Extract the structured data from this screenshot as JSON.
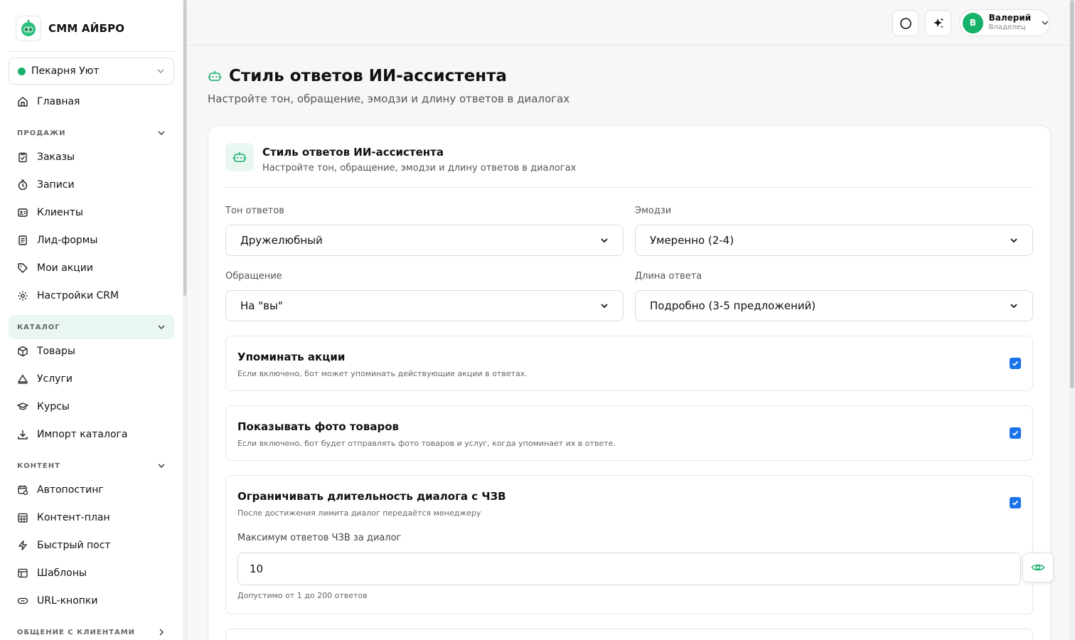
{
  "brand": {
    "name": "СММ АЙБРО"
  },
  "workspace": {
    "name": "Пекарня Уют"
  },
  "nav": {
    "home": "Главная",
    "sections": {
      "sales": "ПРОДАЖИ",
      "catalog": "КАТАЛОГ",
      "content": "КОНТЕНТ",
      "communication": "ОБЩЕНИЕ С КЛИЕНТАМИ"
    },
    "sales_items": [
      "Заказы",
      "Записи",
      "Клиенты",
      "Лид-формы",
      "Мои акции",
      "Настройки CRM"
    ],
    "catalog_items": [
      "Товары",
      "Услуги",
      "Курсы",
      "Импорт каталога"
    ],
    "content_items": [
      "Автопостинг",
      "Контент-план",
      "Быстрый пост",
      "Шаблоны",
      "URL-кнопки"
    ]
  },
  "user": {
    "initial": "В",
    "name": "Валерий",
    "role": "Владелец"
  },
  "page": {
    "title": "Стиль ответов ИИ-ассистента",
    "subtitle": "Настройте тон, обращение, эмодзи и длину ответов в диалогах"
  },
  "card": {
    "title": "Стиль ответов ИИ-ассистента",
    "subtitle": "Настройте тон, обращение, эмодзи и длину ответов в диалогах"
  },
  "fields": {
    "tone": {
      "label": "Тон ответов",
      "value": "Дружелюбный"
    },
    "emoji": {
      "label": "Эмодзи",
      "value": "Умеренно (2-4)"
    },
    "address": {
      "label": "Обращение",
      "value": "На \"вы\""
    },
    "length": {
      "label": "Длина ответа",
      "value": "Подробно (3-5 предложений)"
    }
  },
  "options": {
    "promos": {
      "title": "Упоминать акции",
      "desc": "Если включено, бот может упоминать действующие акции в ответах.",
      "checked": true
    },
    "photos": {
      "title": "Показывать фото товаров",
      "desc": "Если включено, бот будет отправлять фото товаров и услуг, когда упоминает их в ответе.",
      "checked": true
    },
    "limit": {
      "title": "Ограничивать длительность диалога с ЧЗВ",
      "desc": "После достижения лимита диалог передаётся менеджеру",
      "checked": true,
      "max_label": "Максимум ответов ЧЗВ за диалог",
      "max_value": "10",
      "hint": "Допустимо от 1 до 200 ответов"
    }
  },
  "colors": {
    "accent": "#17b26a",
    "checkbox": "#1a73e8",
    "accent_bg": "#eaf7f1"
  }
}
